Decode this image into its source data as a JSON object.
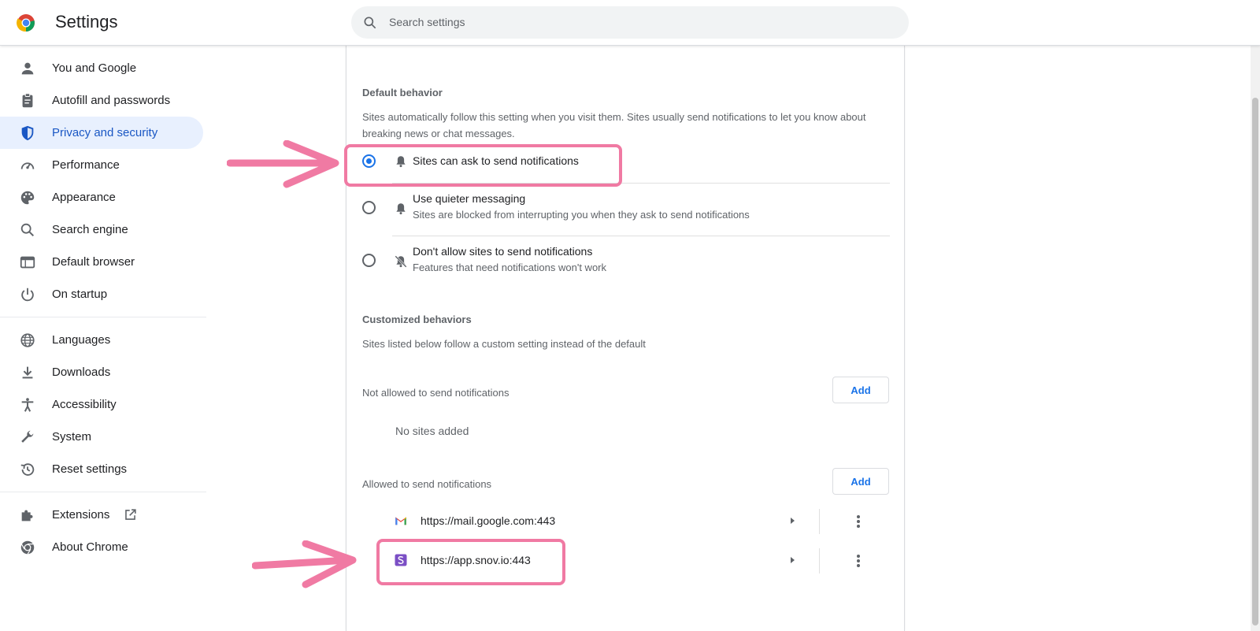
{
  "header": {
    "title": "Settings",
    "search_placeholder": "Search settings"
  },
  "sidebar": {
    "items": [
      {
        "label": "You and Google",
        "icon": "person-icon"
      },
      {
        "label": "Autofill and passwords",
        "icon": "clipboard-icon"
      },
      {
        "label": "Privacy and security",
        "icon": "shield-icon",
        "active": true
      },
      {
        "label": "Performance",
        "icon": "gauge-icon"
      },
      {
        "label": "Appearance",
        "icon": "palette-icon"
      },
      {
        "label": "Search engine",
        "icon": "search-icon"
      },
      {
        "label": "Default browser",
        "icon": "browser-window-icon"
      },
      {
        "label": "On startup",
        "icon": "power-icon"
      }
    ],
    "items2": [
      {
        "label": "Languages",
        "icon": "globe-icon"
      },
      {
        "label": "Downloads",
        "icon": "download-icon"
      },
      {
        "label": "Accessibility",
        "icon": "accessibility-icon"
      },
      {
        "label": "System",
        "icon": "wrench-icon"
      },
      {
        "label": "Reset settings",
        "icon": "history-icon"
      }
    ],
    "items3": [
      {
        "label": "Extensions",
        "icon": "puzzle-icon"
      },
      {
        "label": "About Chrome",
        "icon": "chrome-icon"
      }
    ]
  },
  "main": {
    "default_title": "Default behavior",
    "default_desc": "Sites automatically follow this setting when you visit them. Sites usually send notifications to let you know about breaking news or chat messages.",
    "options": [
      {
        "label": "Sites can ask to send notifications",
        "sub": "",
        "checked": true
      },
      {
        "label": "Use quieter messaging",
        "sub": "Sites are blocked from interrupting you when they ask to send notifications",
        "checked": false
      },
      {
        "label": "Don't allow sites to send notifications",
        "sub": "Features that need notifications won't work",
        "checked": false
      }
    ],
    "custom_title": "Customized behaviors",
    "custom_desc": "Sites listed below follow a custom setting instead of the default",
    "not_allowed_label": "Not allowed to send notifications",
    "add_label": "Add",
    "no_sites": "No sites added",
    "allowed_label": "Allowed to send notifications",
    "allowed_sites": [
      {
        "url": "https://mail.google.com:443",
        "icon": "gmail-icon"
      },
      {
        "url": "https://app.snov.io:443",
        "icon": "snov-icon"
      }
    ]
  },
  "colors": {
    "accent": "#1a73e8",
    "active_bg": "#e8f0fe",
    "highlight": "#f07aa3"
  }
}
